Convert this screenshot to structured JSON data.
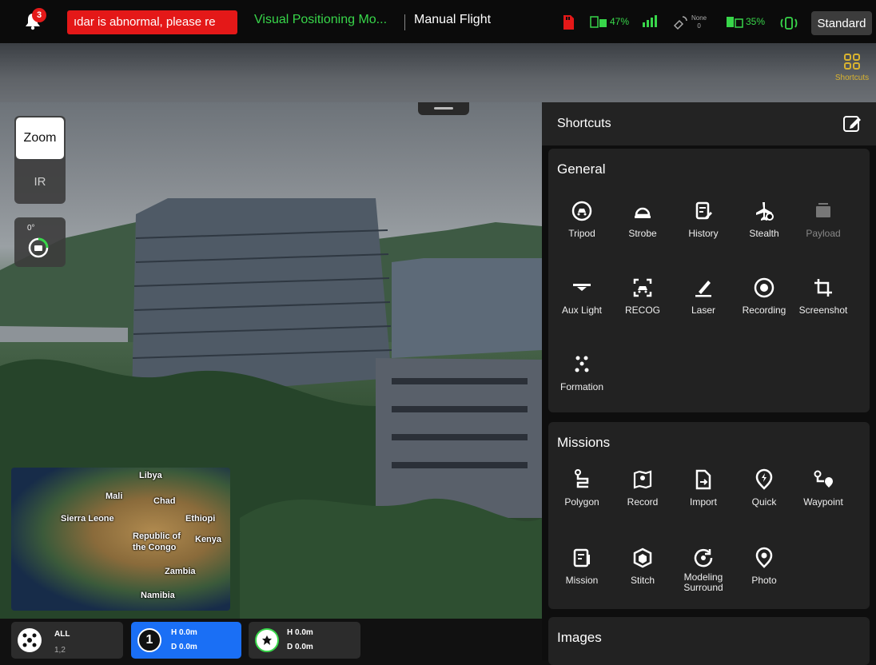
{
  "status": {
    "notification_count": "3",
    "alert_text": "ıdar is abnormal, please re",
    "mode": "Visual Positioning Mo...",
    "flight_mode": "Manual Flight",
    "rc_battery": "47%",
    "gps_label": "None",
    "gps_count": "0",
    "drone_battery": "35%",
    "profile": "Standard"
  },
  "shortcuts_top_label": "Shortcuts",
  "lens": {
    "zoom": "Zoom",
    "ir": "IR",
    "gimbal_angle": "0°"
  },
  "minimap": {
    "labels": [
      "Libya",
      "Mali",
      "Chad",
      "Sierra Leone",
      "Ethiopi",
      "Republic of",
      "the Congo",
      "Kenya",
      "Zambia",
      "Namibia"
    ]
  },
  "bottom": {
    "all_label": "ALL",
    "all_ids": "1,2",
    "drone1_num": "1",
    "drone1_h": "H 0.0m",
    "drone1_d": "D 0.0m",
    "drone2_h": "H 0.0m",
    "drone2_d": "D 0.0m"
  },
  "panel": {
    "title": "Shortcuts",
    "general": {
      "title": "General",
      "items": [
        "Tripod",
        "Strobe",
        "History",
        "Stealth",
        "Payload",
        "Aux Light",
        "RECOG",
        "Laser",
        "Recording",
        "Screenshot",
        "Formation"
      ]
    },
    "missions": {
      "title": "Missions",
      "items": [
        "Polygon",
        "Record",
        "Import",
        "Quick",
        "Waypoint",
        "Mission",
        "Stitch",
        "Modeling Surround",
        "Photo"
      ]
    },
    "images": {
      "title": "Images"
    }
  },
  "colors": {
    "accent_green": "#38d64a",
    "alert_red": "#e41818",
    "selected_blue": "#1a6ff5",
    "shortcut_gold": "#d9b32f"
  }
}
